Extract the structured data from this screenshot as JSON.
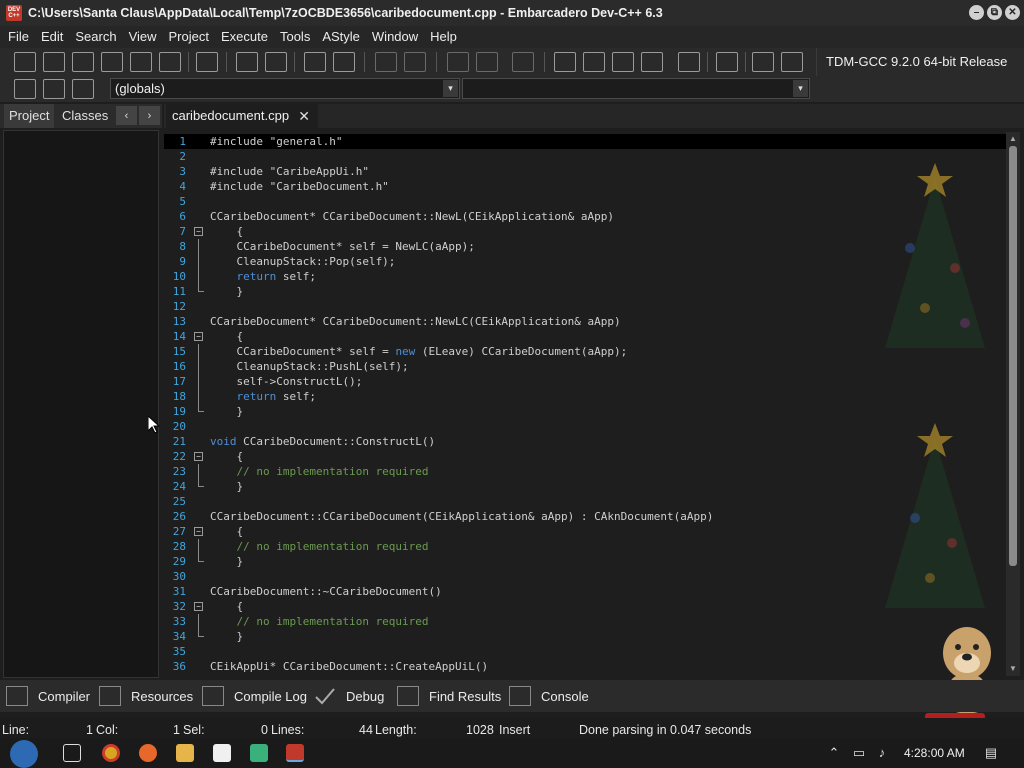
{
  "window": {
    "icon_text": "DEV C++",
    "title": "C:\\Users\\Santa Claus\\AppData\\Local\\Temp\\7zOCBDE3656\\caribedocument.cpp - Embarcadero Dev-C++ 6.3",
    "min_glyph": "–",
    "max_glyph": "⧉",
    "close_glyph": "✕"
  },
  "menu": [
    "File",
    "Edit",
    "Search",
    "View",
    "Project",
    "Execute",
    "Tools",
    "AStyle",
    "Window",
    "Help"
  ],
  "toolbar": {
    "compiler": "TDM-GCC 9.2.0 64-bit Release"
  },
  "toolbar2": {
    "scope": "(globals)",
    "arrow": "▾"
  },
  "left_tabs": {
    "project": "Project",
    "classes": "Classes",
    "prev": "‹",
    "next": "›"
  },
  "editor": {
    "tab_label": "caribedocument.cpp",
    "close_glyph": "✕",
    "lines": [
      {
        "n": "1",
        "code": "#include \"general.h\"",
        "fold": "",
        "current": true
      },
      {
        "n": "2",
        "code": "",
        "fold": ""
      },
      {
        "n": "3",
        "code": "#include \"CaribeAppUi.h\"",
        "fold": ""
      },
      {
        "n": "4",
        "code": "#include \"CaribeDocument.h\"",
        "fold": ""
      },
      {
        "n": "5",
        "code": "",
        "fold": ""
      },
      {
        "n": "6",
        "code": "CCaribeDocument* CCaribeDocument::NewL(CEikApplication& aApp)",
        "fold": ""
      },
      {
        "n": "7",
        "code": "    {",
        "fold": "start"
      },
      {
        "n": "8",
        "code": "    CCaribeDocument* self = NewLC(aApp);",
        "fold": "mid"
      },
      {
        "n": "9",
        "code": "    CleanupStack::Pop(self);",
        "fold": "mid"
      },
      {
        "n": "10",
        "code": "    return self;",
        "fold": "mid"
      },
      {
        "n": "11",
        "code": "    }",
        "fold": "end"
      },
      {
        "n": "12",
        "code": "",
        "fold": ""
      },
      {
        "n": "13",
        "code": "CCaribeDocument* CCaribeDocument::NewLC(CEikApplication& aApp)",
        "fold": ""
      },
      {
        "n": "14",
        "code": "    {",
        "fold": "start"
      },
      {
        "n": "15",
        "code": "    CCaribeDocument* self = new (ELeave) CCaribeDocument(aApp);",
        "fold": "mid"
      },
      {
        "n": "16",
        "code": "    CleanupStack::PushL(self);",
        "fold": "mid"
      },
      {
        "n": "17",
        "code": "    self->ConstructL();",
        "fold": "mid"
      },
      {
        "n": "18",
        "code": "    return self;",
        "fold": "mid"
      },
      {
        "n": "19",
        "code": "    }",
        "fold": "end"
      },
      {
        "n": "20",
        "code": "",
        "fold": ""
      },
      {
        "n": "21",
        "code": "void CCaribeDocument::ConstructL()",
        "fold": ""
      },
      {
        "n": "22",
        "code": "    {",
        "fold": "start"
      },
      {
        "n": "23",
        "code": "    // no implementation required",
        "fold": "mid"
      },
      {
        "n": "24",
        "code": "    }",
        "fold": "end"
      },
      {
        "n": "25",
        "code": "",
        "fold": ""
      },
      {
        "n": "26",
        "code": "CCaribeDocument::CCaribeDocument(CEikApplication& aApp) : CAknDocument(aApp)",
        "fold": ""
      },
      {
        "n": "27",
        "code": "    {",
        "fold": "start"
      },
      {
        "n": "28",
        "code": "    // no implementation required",
        "fold": "mid"
      },
      {
        "n": "29",
        "code": "    }",
        "fold": "end"
      },
      {
        "n": "30",
        "code": "",
        "fold": ""
      },
      {
        "n": "31",
        "code": "CCaribeDocument::~CCaribeDocument()",
        "fold": ""
      },
      {
        "n": "32",
        "code": "    {",
        "fold": "start"
      },
      {
        "n": "33",
        "code": "    // no implementation required",
        "fold": "mid"
      },
      {
        "n": "34",
        "code": "    }",
        "fold": "end"
      },
      {
        "n": "35",
        "code": "",
        "fold": ""
      },
      {
        "n": "36",
        "code": "CEikAppUi* CCaribeDocument::CreateAppUiL()",
        "fold": ""
      }
    ]
  },
  "bottom_tabs": [
    "Compiler",
    "Resources",
    "Compile Log",
    "Debug",
    "Find Results",
    "Console"
  ],
  "status": {
    "line_label": "Line:",
    "line_value": "1",
    "col_label": "Col:",
    "col_value": "1",
    "sel_label": "Sel:",
    "sel_value": "0",
    "lines_label": "Lines:",
    "lines_value": "44",
    "length_label": "Length:",
    "length_value": "1028",
    "mode": "Insert",
    "message": "Done parsing in 0.047 seconds"
  },
  "taskbar": {
    "time": "4:28:00 AM"
  },
  "colors": {
    "line_number": "#3fa6e0",
    "keyword": "#4e8fd6",
    "comment": "#6a9a4f",
    "text": "#cfcfcf"
  }
}
